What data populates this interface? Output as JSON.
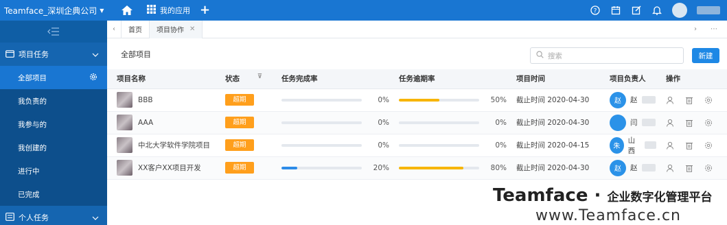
{
  "topbar": {
    "company": "Teamface_深圳企典公司",
    "apps_label": "我的应用"
  },
  "sidebar": {
    "group1": "项目任务",
    "items": [
      "全部项目",
      "我负责的",
      "我参与的",
      "我创建的",
      "进行中",
      "已完成"
    ],
    "group2": "个人任务"
  },
  "tabs": [
    {
      "label": "首页"
    },
    {
      "label": "项目协作"
    }
  ],
  "main": {
    "title": "全部项目",
    "search_placeholder": "搜索",
    "new_label": "新建"
  },
  "table": {
    "headers": [
      "项目名称",
      "状态",
      "任务完成率",
      "任务逾期率",
      "项目时间",
      "项目负责人",
      "操作"
    ],
    "rows": [
      {
        "name": "BBB",
        "status": "超期",
        "completion": 0,
        "completion_text": "0%",
        "overdue": 50,
        "overdue_text": "50%",
        "time": "截止时间 2020-04-30",
        "owner_avatar": "赵",
        "owner_name": "赵"
      },
      {
        "name": "AAA",
        "status": "超期",
        "completion": 0,
        "completion_text": "0%",
        "overdue": 0,
        "overdue_text": "0%",
        "time": "截止时间 2020-04-30",
        "owner_avatar": "",
        "owner_name": "闫"
      },
      {
        "name": "中北大学软件学院项目",
        "status": "超期",
        "completion": 0,
        "completion_text": "0%",
        "overdue": 0,
        "overdue_text": "0%",
        "time": "截止时间 2020-04-15",
        "owner_avatar": "朱",
        "owner_name": "山西"
      },
      {
        "name": "XX客户XX项目开发",
        "status": "超期",
        "completion": 20,
        "completion_text": "20%",
        "overdue": 80,
        "overdue_text": "80%",
        "time": "截止时间 2020-04-30",
        "owner_avatar": "赵",
        "owner_name": "赵"
      }
    ]
  },
  "colors": {
    "completion_bar": "#2d8ce8",
    "overdue_bar": "#f7b500",
    "status_badge": "#ff9f1c",
    "topbar": "#1976d2",
    "sidebar": "#0f5ea5"
  },
  "watermark": {
    "brand": "Teamface",
    "slogan": "企业数字化管理平台",
    "url": "www.Teamface.cn"
  }
}
